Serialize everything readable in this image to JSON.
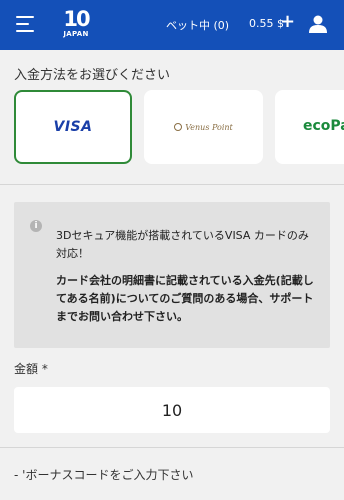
{
  "header": {
    "logo": {
      "mark": "10",
      "sub": "JAPAN"
    },
    "bet_label": "ベット中 (0)",
    "balance": "0.55 $",
    "plus": "+"
  },
  "payment": {
    "title": "入金方法をお選びください",
    "methods": [
      {
        "label": "VISA",
        "selected": true
      },
      {
        "label": "Venus Point",
        "selected": false
      },
      {
        "label": "ecoPa",
        "selected": false
      }
    ]
  },
  "notice": {
    "icon": "i",
    "text": "3Dセキュア機能が搭載されているVISA カードのみ対応！",
    "bold_text": "カード会社の明細書に記載されている入金先(記載してある名前)についてのご質問のある場合、サポートまでお問い合わせ下さい。"
  },
  "amount": {
    "label": "金額 *",
    "value": "10"
  },
  "bonus": {
    "label": "- 'ボーナスコードをご入力下さい"
  },
  "colors": {
    "header_bg": "#1450b8",
    "selected_border": "#2f8a38",
    "visa": "#1a3fa8",
    "eco": "#1b8a3c"
  }
}
